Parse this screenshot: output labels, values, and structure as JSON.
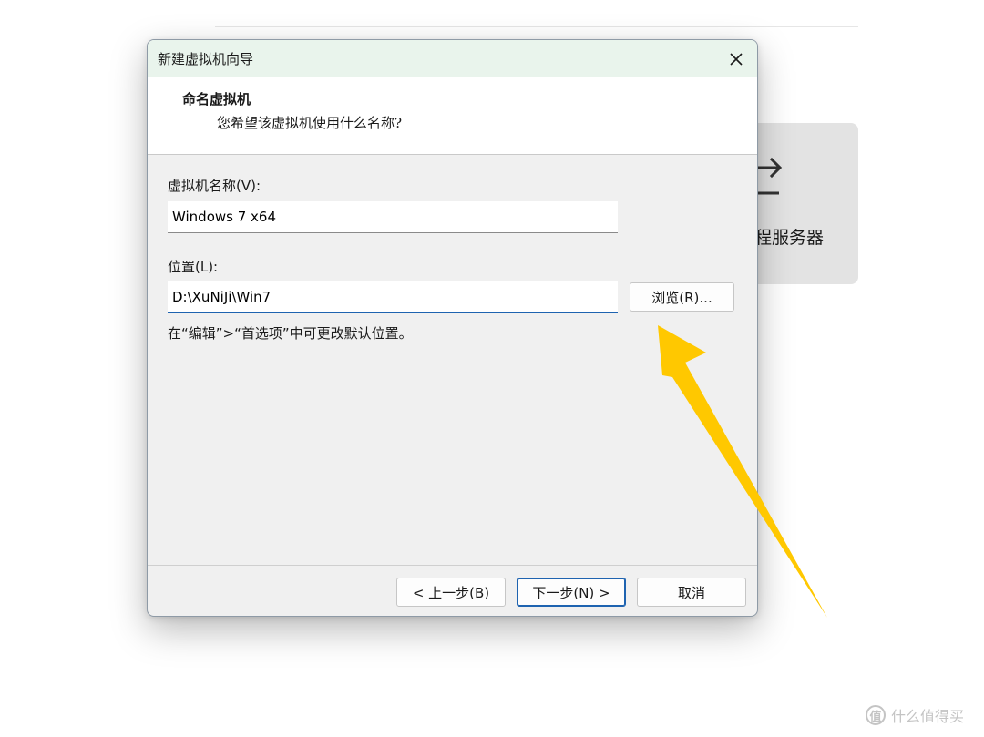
{
  "background_app": {
    "card_label": "程服务器"
  },
  "dialog": {
    "title": "新建虚拟机向导",
    "header": {
      "title": "命名虚拟机",
      "subtitle": "您希望该虚拟机使用什么名称?"
    },
    "name_label": "虚拟机名称(V):",
    "name_value": "Windows 7 x64",
    "location_label": "位置(L):",
    "location_value": "D:\\XuNiJi\\Win7",
    "browse_label": "浏览(R)...",
    "hint": "在“编辑”>“首选项”中可更改默认位置。",
    "buttons": {
      "back": "< 上一步(B)",
      "next": "下一步(N) >",
      "cancel": "取消"
    }
  },
  "annotation": {
    "arrow_color": "#ffc800"
  },
  "watermark": {
    "logo_text": "值",
    "text": "什么值得买"
  }
}
